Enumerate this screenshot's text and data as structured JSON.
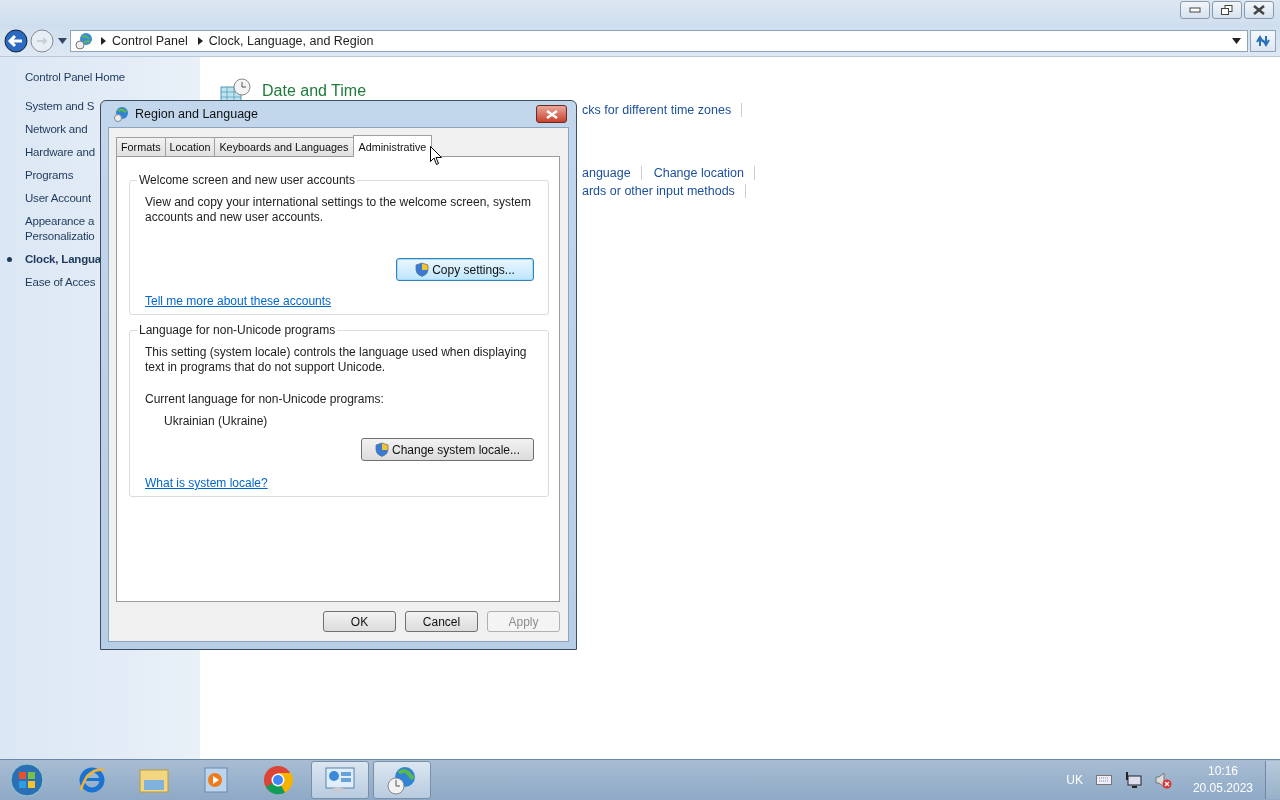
{
  "window": {
    "controls": [
      {
        "kind": "minimize"
      },
      {
        "kind": "restore"
      },
      {
        "kind": "close"
      }
    ]
  },
  "address_bar": {
    "breadcrumbs": [
      "Control Panel",
      "Clock, Language, and Region"
    ]
  },
  "sidebar": {
    "home": "Control Panel Home",
    "items": [
      {
        "lines": [
          "System and S"
        ],
        "selected": false
      },
      {
        "lines": [
          "Network and"
        ],
        "selected": false
      },
      {
        "lines": [
          "Hardware and"
        ],
        "selected": false
      },
      {
        "lines": [
          "Programs"
        ],
        "selected": false
      },
      {
        "lines": [
          "User Account"
        ],
        "selected": false
      },
      {
        "lines": [
          "Appearance a",
          "Personalizatio"
        ],
        "selected": false
      },
      {
        "lines": [
          "Clock, Langua"
        ],
        "selected": true
      },
      {
        "lines": [
          "Ease of Acces"
        ],
        "selected": false
      }
    ]
  },
  "content": {
    "category_title": "Date and Time",
    "link_rows": [
      [
        "cks for different time zones"
      ],
      [
        "anguage",
        "Change location"
      ],
      [
        "ards or other input methods"
      ]
    ]
  },
  "dialog": {
    "title": "Region and Language",
    "tabs": [
      {
        "label": "Formats",
        "selected": false
      },
      {
        "label": "Location",
        "selected": false
      },
      {
        "label": "Keyboards and Languages",
        "selected": false
      },
      {
        "label": "Administrative",
        "selected": true
      }
    ],
    "welcome_group": {
      "title": "Welcome screen and new user accounts",
      "description": "View and copy your international settings to the welcome screen, system accounts and new user accounts.",
      "button": {
        "label": "Copy settings...",
        "focused": true
      },
      "link": "Tell me more about these accounts"
    },
    "locale_group": {
      "title": "Language for non-Unicode programs",
      "description": "This setting (system locale) controls the language used when displaying text in programs that do not support Unicode.",
      "current_label": "Current language for non-Unicode programs:",
      "current_value": "Ukrainian (Ukraine)",
      "button": {
        "label": "Change system locale...",
        "focused": false
      },
      "link": "What is system locale?"
    },
    "buttons": [
      {
        "label": "OK",
        "disabled": false
      },
      {
        "label": "Cancel",
        "disabled": false
      },
      {
        "label": "Apply",
        "disabled": true
      }
    ]
  },
  "taskbar": {
    "items": [
      {
        "kind": "ie",
        "open": false
      },
      {
        "kind": "folder",
        "open": false
      },
      {
        "kind": "media",
        "open": false
      },
      {
        "kind": "chrome",
        "open": false
      },
      {
        "kind": "control-panel",
        "open": true
      },
      {
        "kind": "region",
        "open": true
      }
    ],
    "language": "UK",
    "time": "10:16",
    "date": "20.05.2023"
  }
}
